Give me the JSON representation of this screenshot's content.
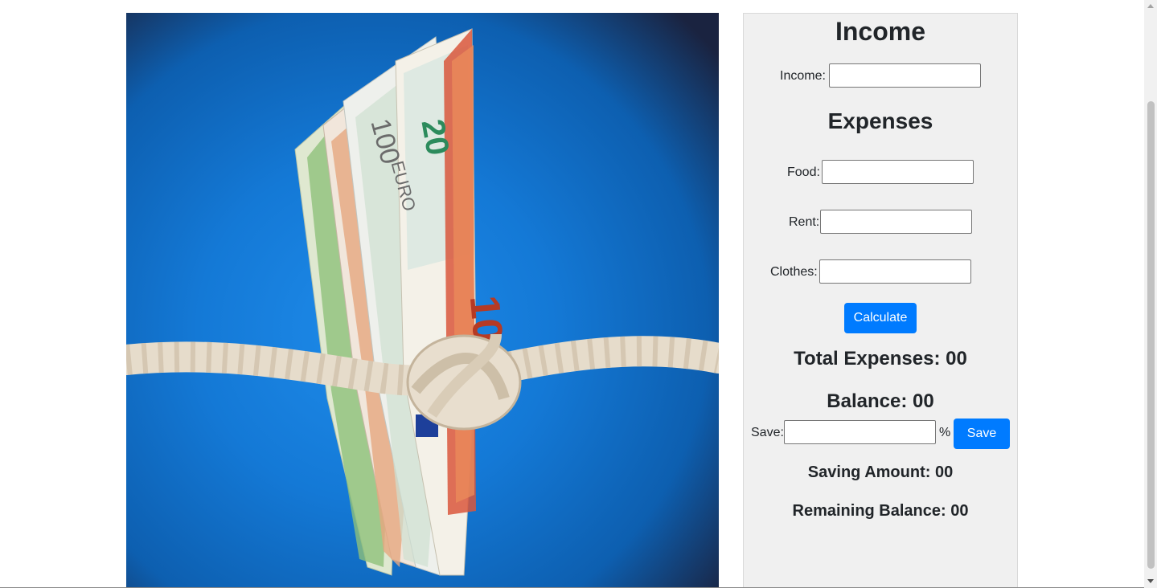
{
  "income": {
    "heading": "Income",
    "income_label": "Income:"
  },
  "expenses": {
    "heading": "Expenses",
    "food_label": "Food:",
    "rent_label": "Rent:",
    "clothes_label": "Clothes:",
    "calculate_label": "Calculate"
  },
  "results": {
    "total_expenses": "Total Expenses: 00",
    "balance": "Balance: 00",
    "save_label": "Save:",
    "percent_sign": "%",
    "save_button": "Save",
    "saving_amount": "Saving Amount: 00",
    "remaining_balance": "Remaining Balance: 00"
  },
  "hero_image": {
    "banknote_labels": [
      "20",
      "100",
      "EURO",
      "10"
    ]
  },
  "colors": {
    "primary_button": "#007bff",
    "panel_background": "#f0f0f0",
    "hero_background": "#1479d6"
  }
}
